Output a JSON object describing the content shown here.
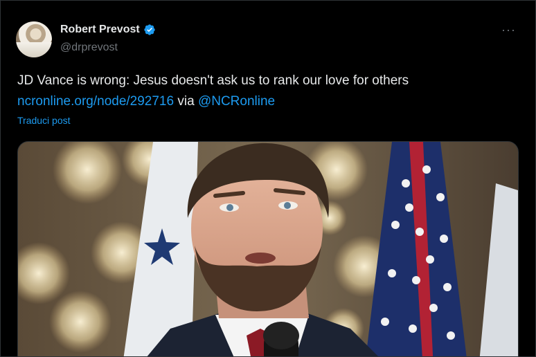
{
  "author": {
    "display_name": "Robert Prevost",
    "handle": "@drprevost",
    "avatar_icon": "profile-photo",
    "verified_icon": "verified-badge-icon"
  },
  "menu": {
    "more_label": "···"
  },
  "tweet": {
    "text": "JD Vance is wrong: Jesus doesn't ask us to rank our love for others",
    "link_text": "ncronline.org/node/292716",
    "via_text": " via ",
    "mention": "@NCRonline",
    "translate_label": "Traduci post"
  },
  "colors": {
    "background": "#000000",
    "text": "#e7e9ea",
    "secondary": "#71767b",
    "link": "#1d9bf0",
    "verified": "#1d9bf0"
  },
  "media": {
    "type": "photo",
    "subject": "man speaking at microphone with flags"
  }
}
